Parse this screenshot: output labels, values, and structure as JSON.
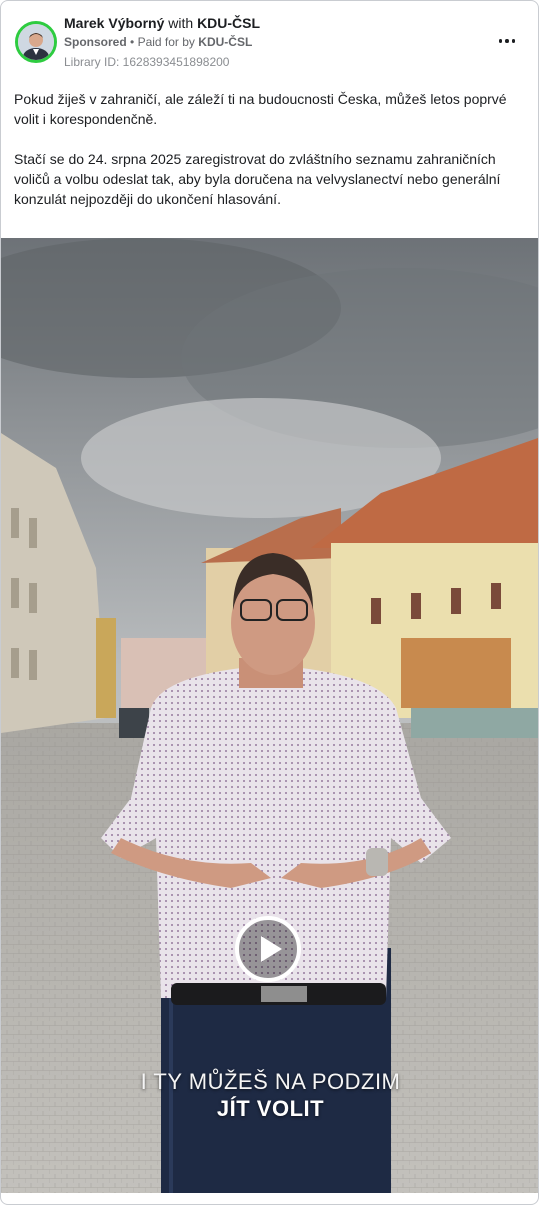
{
  "ad": {
    "page_name": "Marek Výborný",
    "with_text": "with",
    "partner_name": "KDU-ČSL",
    "sponsored_label": "Sponsored",
    "separator": "•",
    "paid_for_text": "Paid for by",
    "paid_for_name": "KDU-ČSL",
    "library_id": "Library ID: 1628393451898200",
    "more_icon": "more-horizontal-icon"
  },
  "body": {
    "paragraph_1": "Pokud žiješ v zahraničí, ale záleží ti na budoucnosti Česka, můžeš letos poprvé volit i korespondenčně.",
    "paragraph_2": "Stačí se do 24. srpna 2025 zaregistrovat do zvláštního seznamu zahraničních voličů a volbu odeslat tak, aby byla doručena na velvyslanectví nebo generální konzulát nejpozději do ukončení hlasování.",
    "ellipsis": "..."
  },
  "video": {
    "caption_line_1": "I TY MŮŽEŠ NA PODZIM",
    "caption_line_2": "JÍT VOLIT",
    "play_icon": "play-icon"
  },
  "colors": {
    "avatar_ring": "#2ecc40",
    "text": "#1c1e21",
    "muted": "#65676b"
  }
}
